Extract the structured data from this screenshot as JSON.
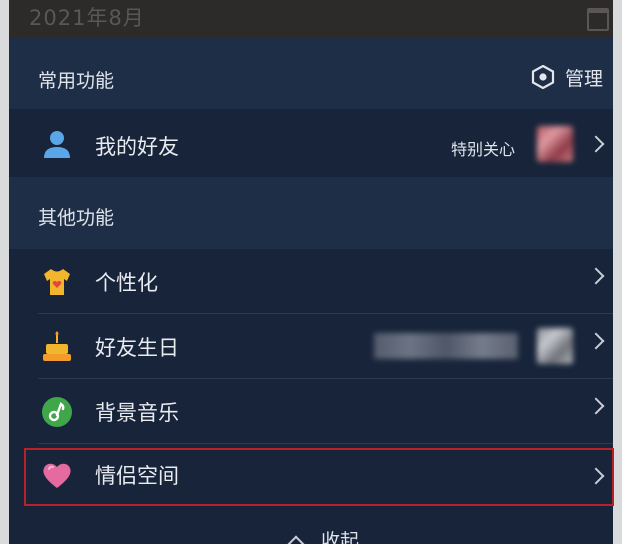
{
  "header": {
    "month": "2021年8月",
    "calendar_icon": "calendar-icon"
  },
  "common_section": {
    "title": "常用功能",
    "manage_label": "管理",
    "manage_icon": "hexagon-gear-icon",
    "items": [
      {
        "label": "我的好友",
        "icon": "person-icon",
        "extra": "特别关心"
      }
    ]
  },
  "other_section": {
    "title": "其他功能",
    "items": [
      {
        "label": "个性化",
        "icon": "shirt-icon"
      },
      {
        "label": "好友生日",
        "icon": "cake-icon"
      },
      {
        "label": "背景音乐",
        "icon": "music-note-icon"
      },
      {
        "label": "情侣空间",
        "icon": "heart-icon",
        "highlighted": true
      }
    ]
  },
  "footer": {
    "collapse_label": "收起",
    "collapse_icon": "chevron-up-icon"
  },
  "colors": {
    "panel_bg": "#17243a",
    "section_bg": "#1f2e47",
    "highlight_border": "#b72228",
    "text": "#e8ebf0"
  }
}
